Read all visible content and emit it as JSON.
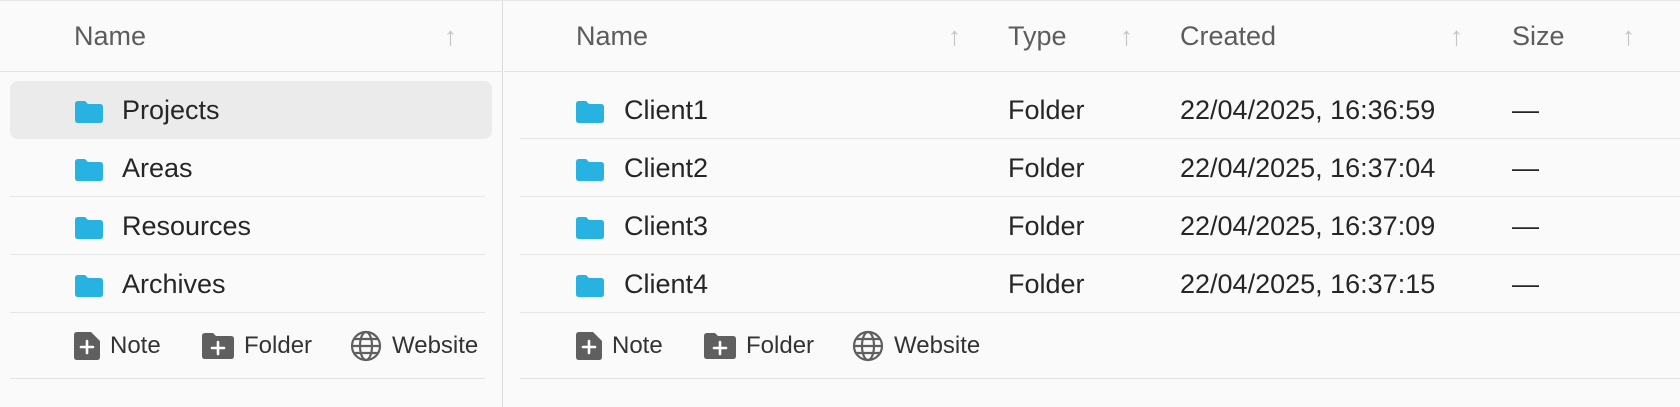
{
  "colors": {
    "folder": "#27b2e2",
    "selected_row": "#ebebeb",
    "muted_text": "#5c5c5c"
  },
  "sidebar": {
    "header": {
      "name": "Name",
      "sort_icon": "arrow-up-icon"
    },
    "items": [
      {
        "label": "Projects",
        "icon": "folder-icon",
        "selected": true
      },
      {
        "label": "Areas",
        "icon": "folder-icon"
      },
      {
        "label": "Resources",
        "icon": "folder-icon"
      },
      {
        "label": "Archives",
        "icon": "folder-icon"
      }
    ],
    "actions": [
      {
        "label": "Note",
        "icon": "add-note-icon"
      },
      {
        "label": "Folder",
        "icon": "add-folder-icon"
      },
      {
        "label": "Website",
        "icon": "globe-icon"
      }
    ]
  },
  "main": {
    "columns": [
      "Name",
      "Type",
      "Created",
      "Size"
    ],
    "rows": [
      {
        "name": "Client1",
        "type": "Folder",
        "created": "22/04/2025, 16:36:59",
        "size": "—"
      },
      {
        "name": "Client2",
        "type": "Folder",
        "created": "22/04/2025, 16:37:04",
        "size": "—"
      },
      {
        "name": "Client3",
        "type": "Folder",
        "created": "22/04/2025, 16:37:09",
        "size": "—"
      },
      {
        "name": "Client4",
        "type": "Folder",
        "created": "22/04/2025, 16:37:15",
        "size": "—"
      }
    ],
    "actions": [
      {
        "label": "Note",
        "icon": "add-note-icon"
      },
      {
        "label": "Folder",
        "icon": "add-folder-icon"
      },
      {
        "label": "Website",
        "icon": "globe-icon"
      }
    ]
  }
}
